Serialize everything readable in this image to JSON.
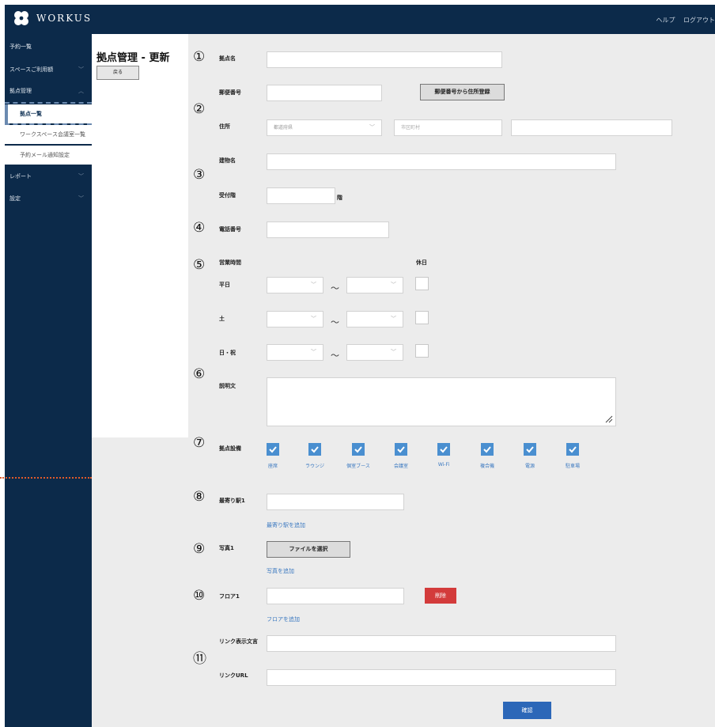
{
  "header": {
    "logo_text": "WORKUS",
    "help_label": "ヘルプ",
    "logout_label": "ログアウト"
  },
  "sidebar": {
    "items": [
      {
        "label": "予約一覧"
      },
      {
        "label": "スペースご利用額"
      },
      {
        "label": "拠点管理"
      },
      {
        "label": "レポート"
      },
      {
        "label": "設定"
      }
    ],
    "subitems": [
      {
        "label": "拠点一覧",
        "active": true
      },
      {
        "label": "ワークスペース会議室一覧",
        "active": false
      },
      {
        "label": "予約メール通知設定",
        "active": false
      }
    ]
  },
  "page": {
    "title": "拠点管理 - 更新",
    "back_label": "戻る"
  },
  "markers": [
    "①",
    "②",
    "③",
    "④",
    "⑤",
    "⑥",
    "⑦",
    "⑧",
    "⑨",
    "⑩",
    "⑪"
  ],
  "form": {
    "base_name_label": "拠点名",
    "postal_label": "郵便番号",
    "postal_button": "郵便番号から住所登録",
    "address_label": "住所",
    "prefecture_placeholder": "都道府県",
    "city_placeholder": "市区町村",
    "building_label": "建物名",
    "reception_label": "受付階",
    "floor_suffix": "階",
    "phone_label": "電話番号",
    "hours_label": "営業時間",
    "holiday_label": "休日",
    "weekday_label": "平日",
    "saturday_label": "土",
    "sunday_label": "日・祝",
    "tilde": "～",
    "description_label": "説明文",
    "facilities_label": "拠点設備",
    "facilities": [
      "座席",
      "ラウンジ",
      "個室ブース",
      "会議室",
      "Wi-Fi",
      "複合機",
      "電源",
      "駐車場"
    ],
    "station_label": "最寄り駅1",
    "add_station": "最寄り駅を追加",
    "photo_label": "写真1",
    "file_button": "ファイルを選択",
    "add_photo": "写真を追加",
    "floor_label": "フロア1",
    "delete_button": "削除",
    "add_floor": "フロアを追加",
    "link_text_label": "リンク表示文言",
    "link_url_label": "リンクURL",
    "confirm_button": "確認"
  },
  "colors": {
    "navy": "#0c2a4a",
    "accent_blue": "#2c67b8",
    "danger": "#d33b3b"
  }
}
